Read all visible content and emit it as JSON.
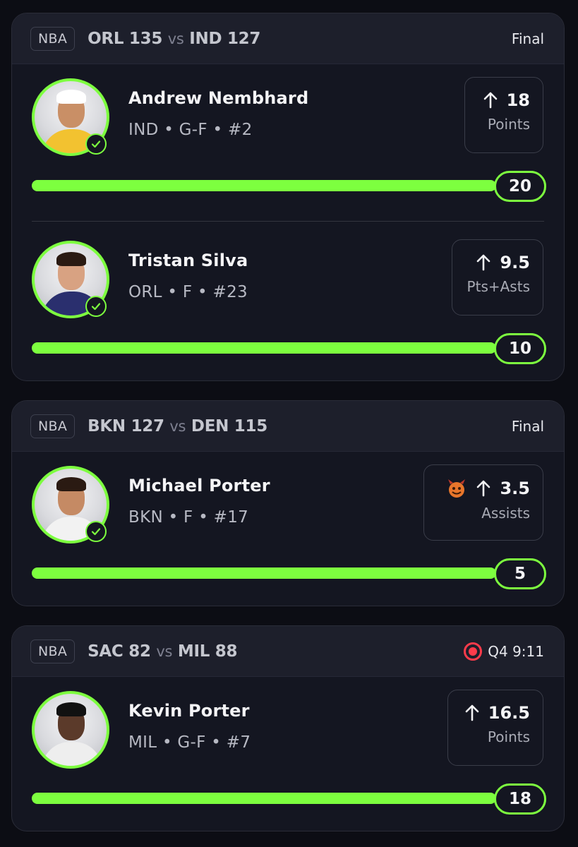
{
  "accent_color": "#7dff3f",
  "live_color": "#ff3b4b",
  "games": [
    {
      "league": "NBA",
      "team1": "ORL",
      "score1": "135",
      "vs": "vs",
      "team2": "IND",
      "score2": "127",
      "status": "Final",
      "picks": [
        {
          "name": "Andrew Nembhard",
          "meta": "IND • G-F • #2",
          "line": "18",
          "stat": "Points",
          "result": "20",
          "progress": 1.0,
          "jersey_color": "#f2c230",
          "skin": "#c98f66",
          "hair": "#1b120d",
          "headband": "#ffffff"
        },
        {
          "name": "Tristan Silva",
          "meta": "ORL • F • #23",
          "line": "9.5",
          "stat": "Pts+Asts",
          "result": "10",
          "progress": 1.0,
          "jersey_color": "#2a2f6e",
          "skin": "#d8a282",
          "hair": "#2a1a12"
        }
      ]
    },
    {
      "league": "NBA",
      "team1": "BKN",
      "score1": "127",
      "vs": "vs",
      "team2": "DEN",
      "score2": "115",
      "status": "Final",
      "picks": [
        {
          "name": "Michael Porter",
          "meta": "BKN • F • #17",
          "line": "3.5",
          "stat": "Assists",
          "result": "5",
          "progress": 1.0,
          "jersey_color": "#f2f2f2",
          "skin": "#c58a64",
          "hair": "#2a1a12",
          "demon_icon": "demon-icon"
        }
      ]
    },
    {
      "league": "NBA",
      "team1": "SAC",
      "score1": "82",
      "vs": "vs",
      "team2": "MIL",
      "score2": "88",
      "status": "Q4 9:11",
      "live": true,
      "picks": [
        {
          "name": "Kevin Porter",
          "meta": "MIL • G-F • #7",
          "line": "16.5",
          "stat": "Points",
          "result": "18",
          "progress": 1.0,
          "jersey_color": "#eeeeee",
          "skin": "#5b3a2a",
          "hair": "#111111"
        }
      ]
    }
  ]
}
